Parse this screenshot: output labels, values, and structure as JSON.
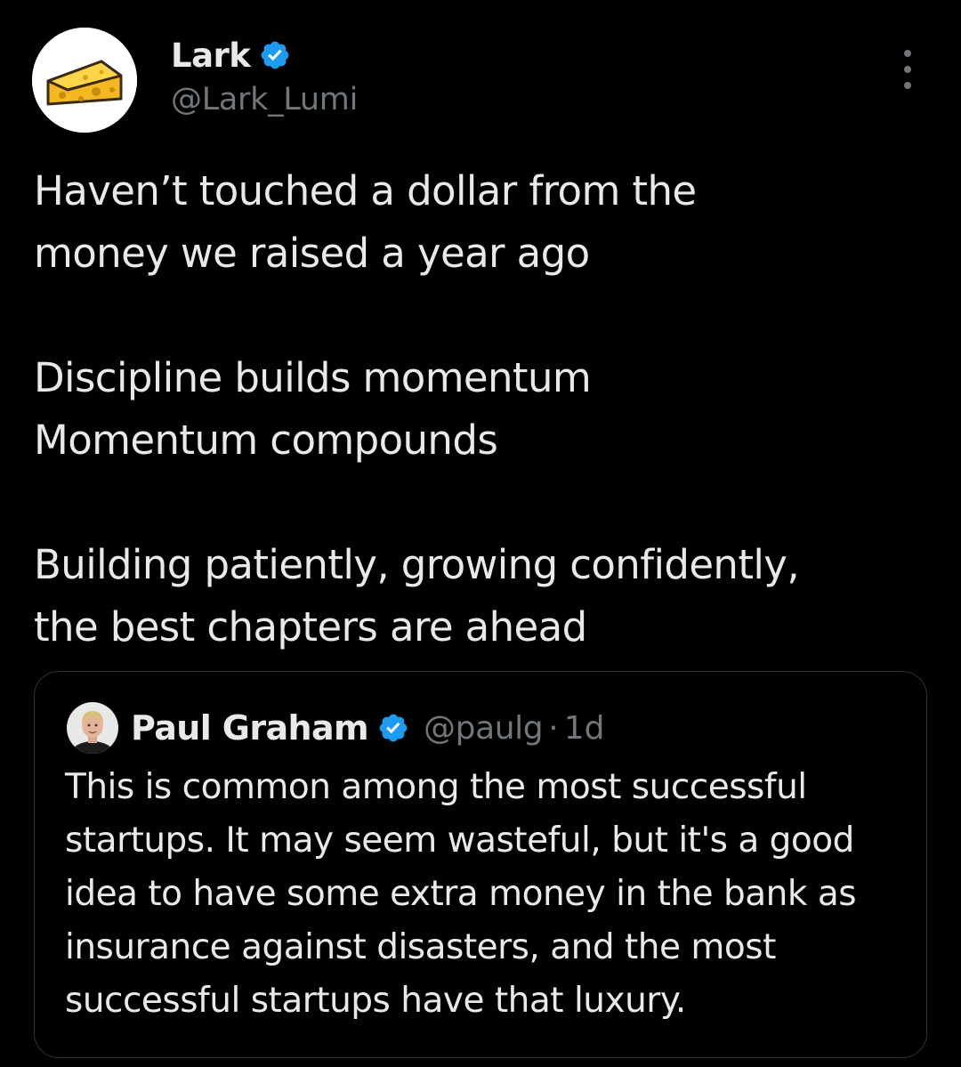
{
  "author": {
    "display_name": "Lark",
    "handle": "@Lark_Lumi",
    "verified": true,
    "avatar_icon": "cheese-icon"
  },
  "tweet": {
    "paragraphs": [
      "Haven’t touched a dollar from the money we raised a year ago",
      "Discipline builds momentum Momentum compounds",
      "Building patiently, growing confidently, the best chapters are ahead"
    ],
    "lines": {
      "p1": [
        "Haven’t touched a dollar from the",
        "money we raised a year ago"
      ],
      "p2": [
        "Discipline builds momentum",
        "Momentum compounds"
      ],
      "p3": [
        "Building patiently, growing confidently,",
        "the best chapters are ahead"
      ]
    }
  },
  "quoted_tweet": {
    "display_name": "Paul Graham",
    "handle": "@paulg",
    "separator": "·",
    "time": "1d",
    "verified": true,
    "text": "This is common among the most successful startups. It may seem wasteful, but it's a good idea to have some extra money in the bank as insurance against disasters, and the most successful startups have that luxury."
  },
  "colors": {
    "background": "#000000",
    "text_primary": "#e7e9ea",
    "text_secondary": "#71767b",
    "verified_badge": "#1d9bf0",
    "card_border": "#2f3336"
  },
  "icons": {
    "verified": "verified-badge-icon",
    "more": "more-options-icon"
  }
}
